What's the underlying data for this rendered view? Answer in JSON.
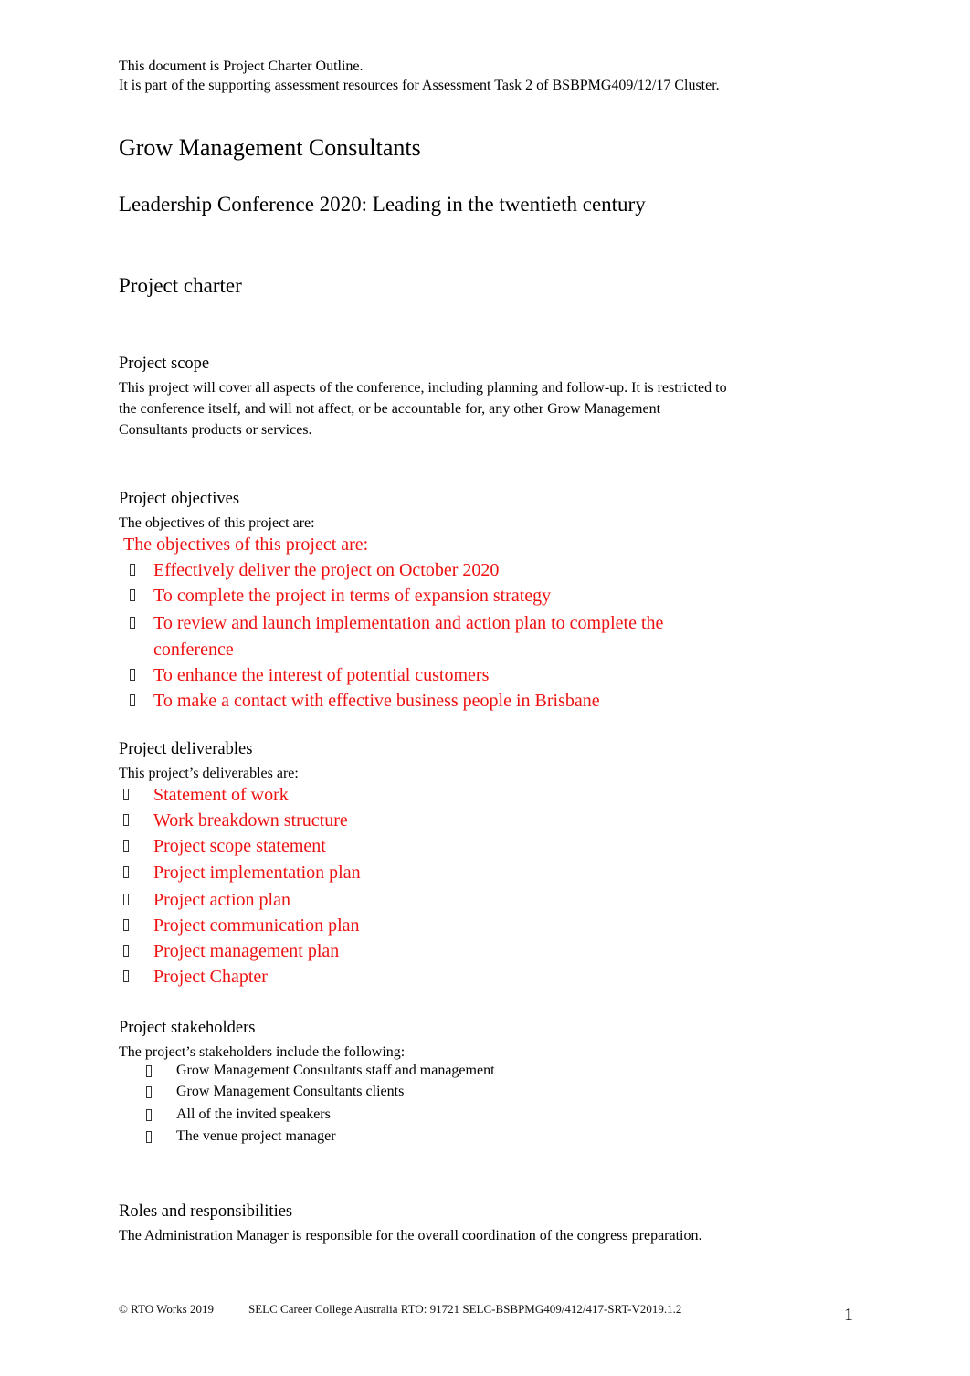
{
  "intro": {
    "line1": "This document is Project Charter Outline.",
    "line2": "It is part of the supporting assessment resources for Assessment Task 2 of BSBPMG409/12/17 Cluster."
  },
  "company": "Grow Management Consultants",
  "conference_title": "Leadership Conference 2020: Leading in the twentieth century",
  "doc_title": "Project charter",
  "scope": {
    "heading": "Project scope",
    "lines": [
      "This project will cover all aspects of the conference, including planning and follow-up. It is restricted to",
      "the conference itself, and will not affect, or be accountable for, any other Grow Management",
      "Consultants products or services."
    ]
  },
  "objectives": {
    "heading": "Project objectives",
    "intro": "The objectives of this project are:",
    "red_intro": "The objectives of this project are:",
    "items": [
      "Effectively deliver the project on October 2020",
      "To complete the project in terms of expansion strategy",
      "To review and launch implementation and action plan to complete the",
      "To enhance the interest of potential customers",
      "To make a contact with effective business people in Brisbane"
    ],
    "item3_cont": "conference"
  },
  "deliverables": {
    "heading": "Project deliverables",
    "intro": "This project’s deliverables are:",
    "items": [
      "Statement of work",
      "Work breakdown structure",
      "Project scope statement",
      "Project implementation plan",
      "Project action plan",
      "Project communication plan",
      "Project management plan",
      "Project Chapter"
    ]
  },
  "stakeholders": {
    "heading": "Project stakeholders",
    "intro": "The project’s stakeholders include the following:",
    "items": [
      "Grow Management Consultants staff and management",
      "Grow Management Consultants clients",
      "All of the invited speakers",
      "The venue project manager"
    ]
  },
  "roles": {
    "heading": "Roles and responsibilities",
    "text": "The Administration Manager is responsible for the overall coordination of the congress preparation."
  },
  "footer": {
    "copyright": "© RTO Works 2019",
    "org": "SELC Career College Australia RTO: 91721 SELC-BSBPMG409/412/417-SRT-V2019.1.2",
    "page_number": "1"
  },
  "colors": {
    "highlight_red": "#ee1111"
  }
}
